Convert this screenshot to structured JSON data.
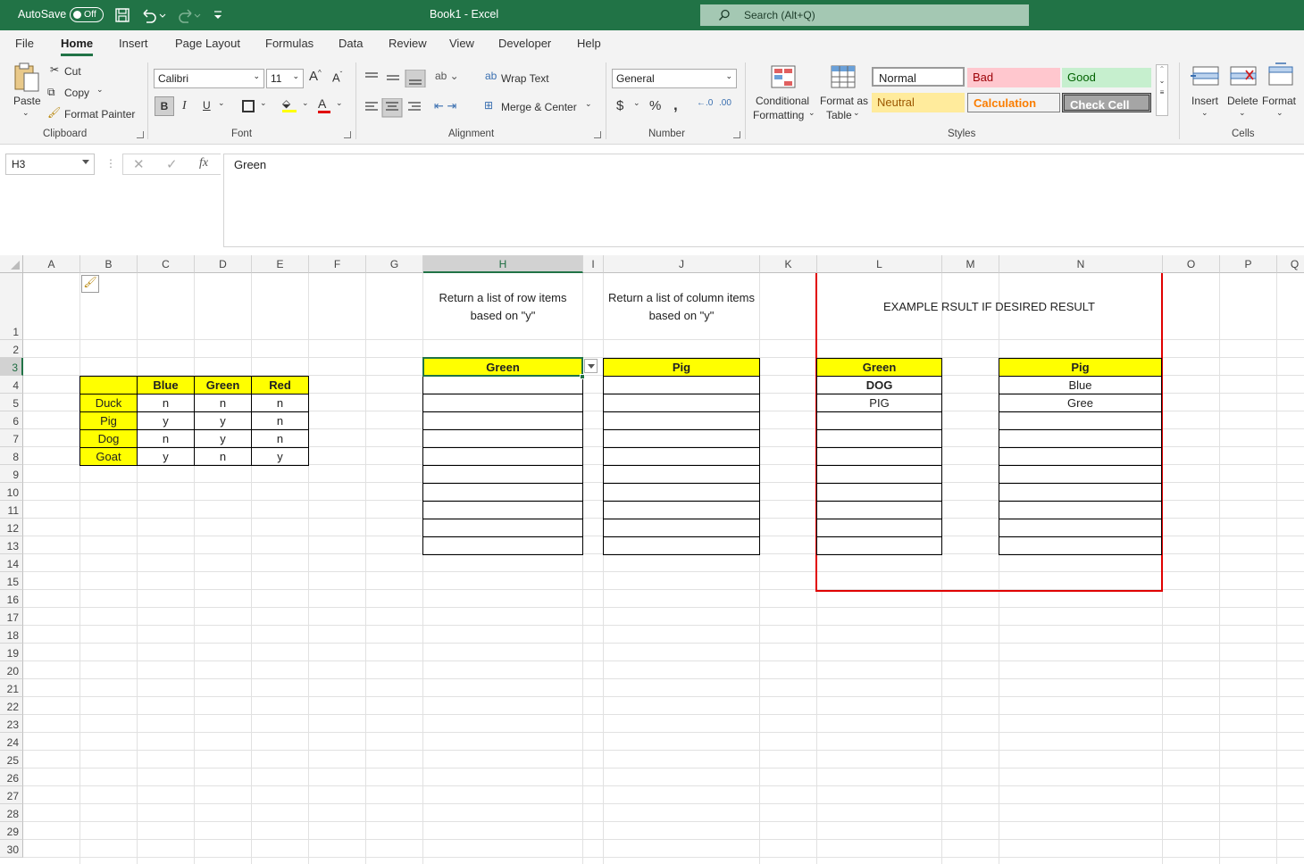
{
  "titlebar": {
    "autosave_label": "AutoSave",
    "toggle_state": "Off",
    "file_title": "Book1  -  Excel",
    "search_placeholder": "Search (Alt+Q)"
  },
  "tabs": [
    "File",
    "Home",
    "Insert",
    "Page Layout",
    "Formulas",
    "Data",
    "Review",
    "View",
    "Developer",
    "Help"
  ],
  "ribbon": {
    "clipboard": {
      "paste": "Paste",
      "cut": "Cut",
      "copy": "Copy",
      "format_painter": "Format Painter",
      "label": "Clipboard"
    },
    "font": {
      "name": "Calibri",
      "size": "11",
      "label": "Font"
    },
    "alignment": {
      "wrap_text": "Wrap Text",
      "merge_center": "Merge & Center",
      "label": "Alignment"
    },
    "number": {
      "format": "General",
      "label": "Number"
    },
    "styles": {
      "conditional_1": "Conditional",
      "conditional_2": "Formatting",
      "format_table_1": "Format as",
      "format_table_2": "Table",
      "normal": "Normal",
      "bad": "Bad",
      "good": "Good",
      "neutral": "Neutral",
      "calculation": "Calculation",
      "check_cell": "Check Cell",
      "label": "Styles"
    },
    "cells": {
      "insert": "Insert",
      "delete": "Delete",
      "format": "Format",
      "label": "Cells"
    }
  },
  "formula_bar": {
    "name_box": "H3",
    "content": "Green"
  },
  "sheet": {
    "columns": [
      "A",
      "B",
      "C",
      "D",
      "E",
      "F",
      "G",
      "H",
      "I",
      "J",
      "K",
      "L",
      "M",
      "N",
      "O",
      "P",
      "Q"
    ],
    "selected_column": "H",
    "selected_row": "3",
    "row_numbers": [
      "1",
      "2",
      "3",
      "4",
      "5",
      "6",
      "7",
      "8",
      "9",
      "10",
      "11",
      "12",
      "13",
      "14",
      "15",
      "16",
      "17",
      "18",
      "19",
      "20",
      "21",
      "22",
      "23",
      "24",
      "25",
      "26",
      "27",
      "28",
      "29",
      "30"
    ],
    "source_table": {
      "headers": [
        "Blue",
        "Green",
        "Red"
      ],
      "rows": [
        {
          "animal": "Duck",
          "values": [
            "n",
            "n",
            "n"
          ]
        },
        {
          "animal": "Pig",
          "values": [
            "y",
            "y",
            "n"
          ]
        },
        {
          "animal": "Dog",
          "values": [
            "n",
            "y",
            "n"
          ]
        },
        {
          "animal": "Goat",
          "values": [
            "y",
            "n",
            "y"
          ]
        }
      ]
    },
    "note_h": "Return a list of row items based on \"y\"",
    "note_j": "Return a list of column items based on \"y\"",
    "h3": "Green",
    "j3": "Pig",
    "example_title": "EXAMPLE RSULT IF DESIRED RESULT",
    "example_l": {
      "header": "Green",
      "items": [
        "DOG",
        "PIG"
      ]
    },
    "example_n": {
      "header": "Pig",
      "items": [
        "Blue",
        "Gree"
      ]
    }
  }
}
